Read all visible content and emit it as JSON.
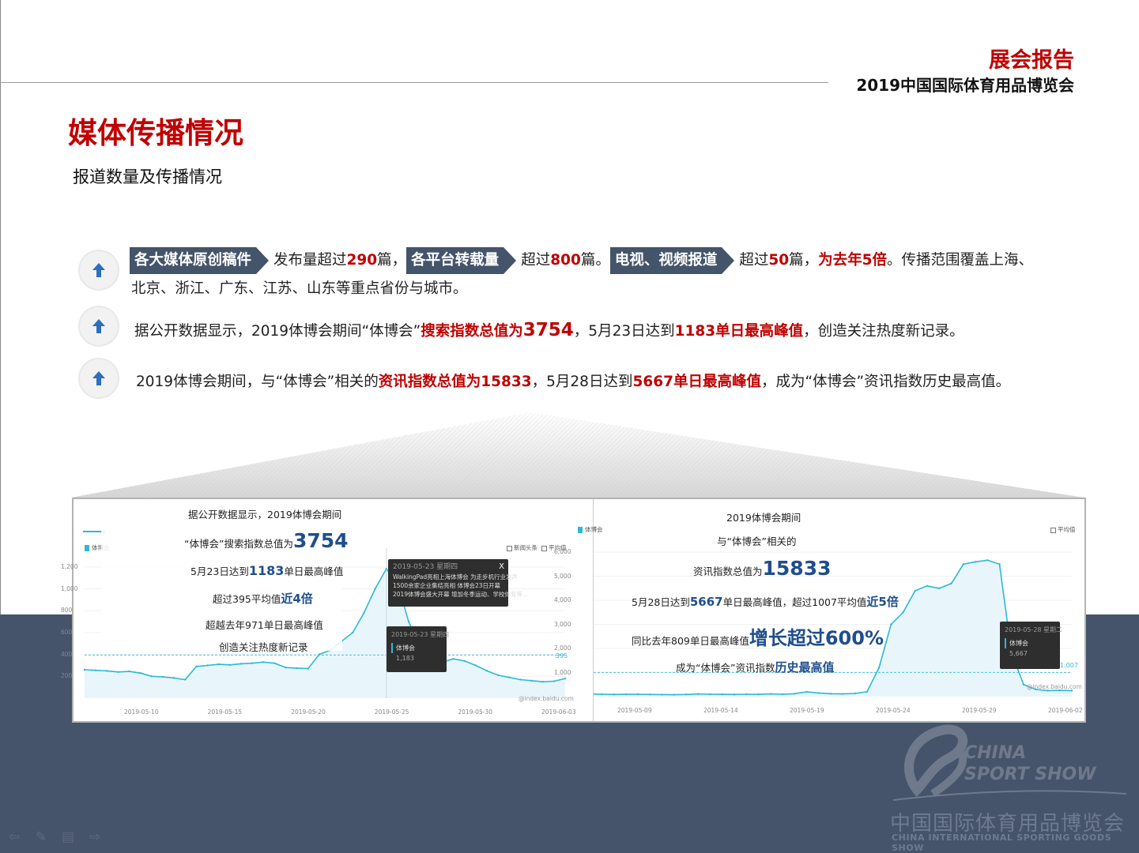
{
  "header": {
    "report_title": "展会报告",
    "expo_name": "2019中国国际体育用品博览会"
  },
  "page_title": "媒体传播情况",
  "subtitle": "报道数量及传播情况",
  "bullets": {
    "b1": {
      "tag1": "各大媒体原创稿件",
      "t1": "发布量超过",
      "v1": "290",
      "t2": "篇，",
      "tag2": "各平台转载量",
      "t3": "超过",
      "v2": "800",
      "t4": "篇。",
      "tag3": "电视、视频报道",
      "t5": "超过",
      "v3": "50",
      "t6": "篇，",
      "v4": "为去年5倍",
      "t7": "。传播范围覆盖上海、",
      "line2": "北京、浙江、广东、江苏、山东等重点省份与城市。"
    },
    "b2": {
      "t1": "据公开数据显示，2019体博会期间“体博会”",
      "r1": "搜索指数总值为",
      "r1big": "3754",
      "t2": "，5月23日达到",
      "r2": "1183单日最高峰值",
      "t3": "，创造关注热度新记录。"
    },
    "b3": {
      "t1": "2019体博会期间，与“体博会”相关的",
      "r1": "资讯指数总值为15833",
      "t2": "，5月28日达到",
      "r2": "5667单日最高峰值",
      "t3": "，成为“体博会”资讯指数历史最高值。"
    }
  },
  "left_chart": {
    "overlay": {
      "l1": "据公开数据显示，2019体博会期间",
      "l2a": "“体博会”搜索指数总值为",
      "l2b": "3754",
      "l3a": "5月23日达到",
      "l3b": "1183",
      "l3c": "单日最高峰值",
      "l4a": "超过395平均值",
      "l4b": "近4倍",
      "l5": "超越去年971单日最高峰值",
      "l6": "创造关注热度新记录"
    },
    "legend": "体博会",
    "legend_right1": "新闻头条",
    "legend_right2": "平均值",
    "tooltip1": {
      "date": "2019-05-23 星期四",
      "close": "X",
      "l1": "WalkingPad亮相上海体博会 为走步机行业发声",
      "l2": "1500余家企业集结亮相 体博会23日开幕",
      "l3": "2019体博会盛大开幕 增加冬季运动、学校体育等..."
    },
    "tooltip2": {
      "date": "2019-05-23 星期四",
      "name": "体博会",
      "value": "1,183"
    },
    "avg_label": "395",
    "source": "@index.baidu.com",
    "y_ticks": [
      "1,200",
      "1,000",
      "800",
      "600",
      "400",
      "200"
    ],
    "x_ticks": [
      "2019-05-10",
      "2019-05-15",
      "2019-05-20",
      "2019-05-25",
      "2019-05-30",
      "2019-06-03"
    ],
    "series": [
      260,
      255,
      250,
      240,
      245,
      230,
      200,
      195,
      185,
      170,
      290,
      300,
      310,
      305,
      315,
      320,
      330,
      320,
      280,
      275,
      270,
      400,
      440,
      520,
      600,
      780,
      1000,
      1183,
      1050,
      700,
      480,
      350,
      330,
      360,
      340,
      300,
      250,
      210,
      190,
      170,
      160,
      150,
      155,
      180
    ]
  },
  "right_chart": {
    "overlay": {
      "l1": "2019体博会期间",
      "l2": "与“体博会”相关的",
      "l3a": "资讯指数总值为",
      "l3b": "15833",
      "l4a": "5月28日达到",
      "l4b": "5667",
      "l4c": "单日最高峰值，超过1007平均值",
      "l4d": "近5倍",
      "l5a": "同比去年809单日最高峰值",
      "l5b": "增长超过600%",
      "l6a": "成为“体博会”资讯指数",
      "l6b": "历史最高值"
    },
    "legend": "体博会",
    "legend_right": "平均值",
    "tooltip": {
      "date": "2019-05-28 星期二",
      "name": "体博会",
      "value": "5,667"
    },
    "avg_label": "1,007",
    "source": "@index.baidu.com",
    "y_ticks": [
      "6,000",
      "5,000",
      "4,000",
      "3,000",
      "2,000",
      "1,000"
    ],
    "x_ticks": [
      "2019-05-09",
      "2019-05-14",
      "2019-05-19",
      "2019-05-24",
      "2019-05-29",
      "2019-06-02"
    ],
    "series": [
      120,
      110,
      100,
      90,
      95,
      100,
      90,
      85,
      80,
      90,
      110,
      100,
      95,
      90,
      100,
      95,
      110,
      100,
      120,
      200,
      150,
      120,
      110,
      130,
      200,
      1200,
      3000,
      3500,
      4400,
      4600,
      4500,
      4700,
      5500,
      5600,
      5667,
      5500,
      1800,
      500,
      300,
      250,
      260,
      250
    ]
  },
  "watermark": {
    "brand_en1": "CHINA",
    "brand_en2": "SPORT SHOW",
    "cn": "中国国际体育用品博览会",
    "en": "CHINA INTERNATIONAL SPORTING GOODS SHOW"
  }
}
